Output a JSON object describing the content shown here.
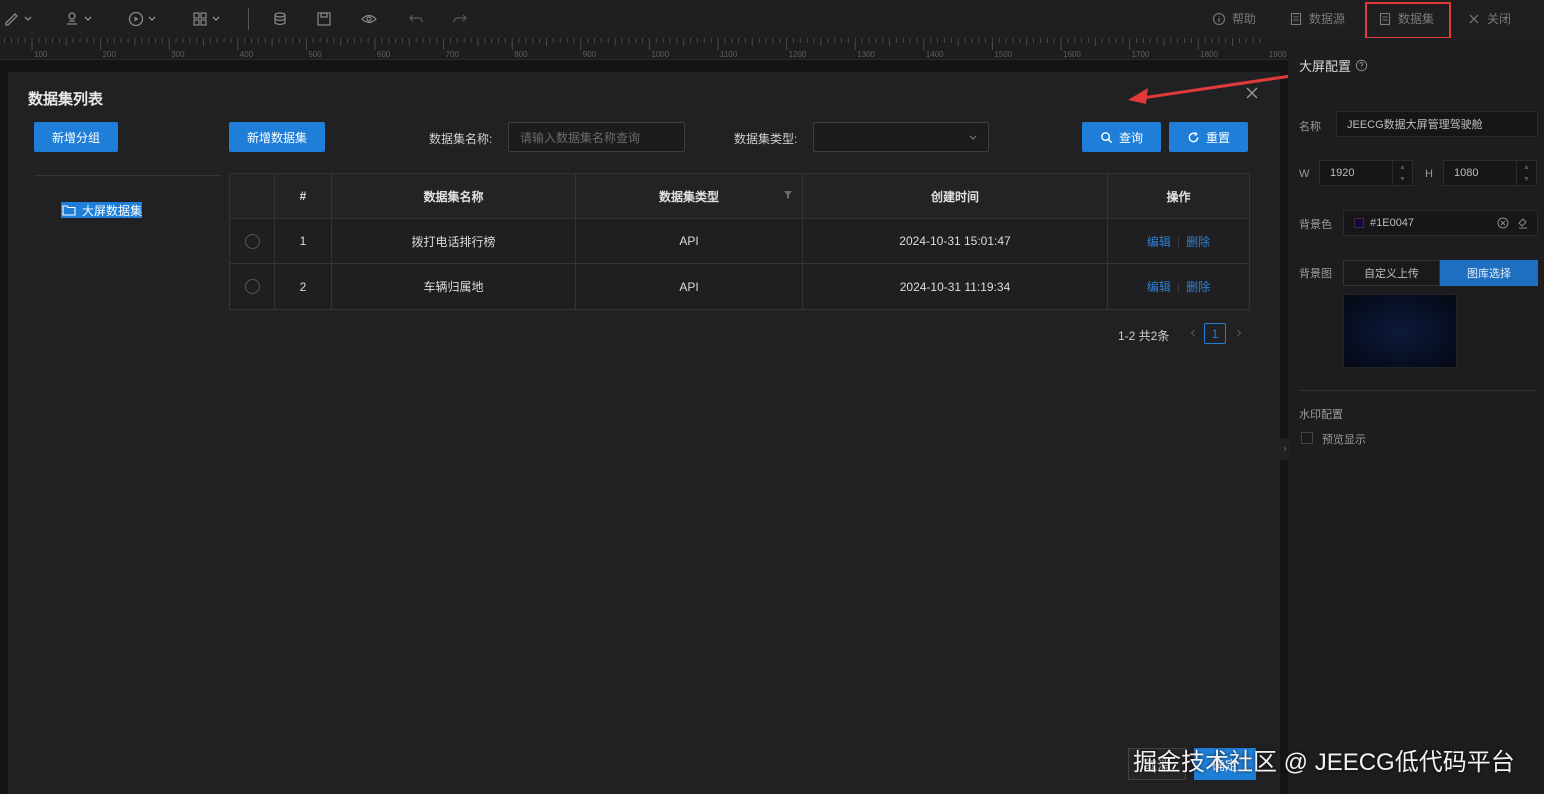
{
  "toolbar": {
    "right_items": [
      {
        "label": "帮助",
        "icon": "help-circle-icon"
      },
      {
        "label": "数据源",
        "icon": "datasource-icon"
      },
      {
        "label": "数据集",
        "icon": "dataset-icon"
      },
      {
        "label": "关闭",
        "icon": "close-icon"
      }
    ]
  },
  "ruler": {
    "labels": [
      "100",
      "200",
      "300",
      "400",
      "500",
      "600",
      "700",
      "800",
      "900",
      "1000",
      "1100",
      "1200",
      "1300",
      "1400",
      "1500",
      "1600",
      "1700",
      "1800",
      "1900"
    ]
  },
  "modal": {
    "title": "数据集列表",
    "add_group_label": "新增分组",
    "add_dataset_label": "新增数据集",
    "name_filter_label": "数据集名称:",
    "name_filter_placeholder": "请输入数据集名称查询",
    "type_filter_label": "数据集类型:",
    "type_filter_value": "",
    "query_label": "查询",
    "reset_label": "重置",
    "tree": {
      "root_label": "大屏数据集"
    },
    "table": {
      "headers": [
        "#",
        "数据集名称",
        "数据集类型",
        "创建时间",
        "操作"
      ],
      "rows": [
        {
          "index": "1",
          "name": "拨打电话排行榜",
          "type": "API",
          "created": "2024-10-31 15:01:47",
          "edit": "编辑",
          "delete": "删除"
        },
        {
          "index": "2",
          "name": "车辆归属地",
          "type": "API",
          "created": "2024-10-31 11:19:34",
          "edit": "编辑",
          "delete": "删除"
        }
      ]
    },
    "pagination": {
      "summary": "1-2 共2条",
      "current_page": "1"
    },
    "footer": {
      "cancel_label": "取消",
      "confirm_label": "确定"
    }
  },
  "right_panel": {
    "title": "大屏配置",
    "name_label": "名称",
    "name_value": "JEECG数据大屏管理驾驶舱",
    "width_label": "W",
    "width_value": "1920",
    "height_label": "H",
    "height_value": "1080",
    "bg_color_label": "背景色",
    "bg_color_value": "#1E0047",
    "bg_image_label": "背景图",
    "upload_label": "自定义上传",
    "gallery_label": "图库选择",
    "watermark_label": "水印配置",
    "preview_label": "预览显示"
  },
  "watermark_text": "掘金技术社区 @ JEECG低代码平台",
  "colors": {
    "accent": "#1f7fd8",
    "highlight_box": "#e03a3a",
    "arrow": "#e03a3a",
    "link": "#2f7fd4"
  }
}
